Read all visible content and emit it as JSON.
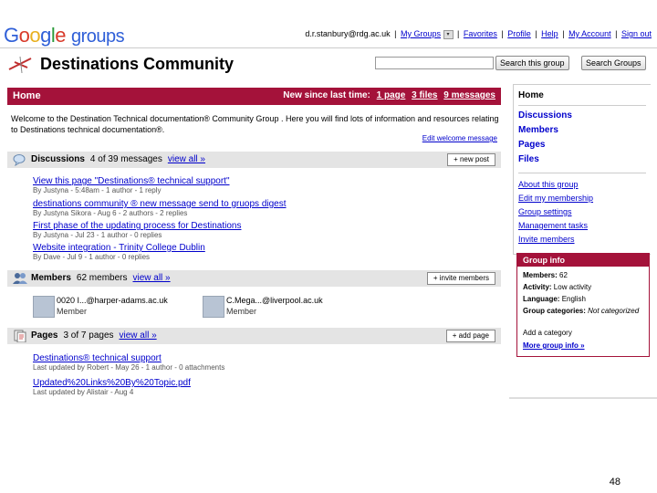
{
  "header": {
    "logo_google": "Google",
    "logo_groups": "groups",
    "email": "d.r.stanbury@rdg.ac.uk",
    "links": [
      "My Groups",
      "Favorites",
      "Profile",
      "Help",
      "My Account",
      "Sign out"
    ]
  },
  "group": {
    "title": "Destinations Community",
    "search_group_label": "Search this group",
    "search_groups_label": "Search Groups"
  },
  "home": {
    "title": "Home",
    "new_since": "New since last time:",
    "new_page": "1 page",
    "new_files": "3 files",
    "new_messages": "9 messages",
    "welcome_text": "Welcome to the Destination Technical documentation® Community Group . Here you will find lots of information and resources relating to Destinations technical documentation®.",
    "edit_welcome": "Edit welcome message"
  },
  "discussions": {
    "label": "Discussions",
    "count": "4 of 39 messages",
    "view_all": "view all »",
    "button": "+ new post",
    "items": [
      {
        "title": "View this page \"Destinations® technical support\"",
        "meta": "By Justyna - 5:48am - 1 author - 1 reply"
      },
      {
        "title": "destinations community ® new message send to gruops digest",
        "meta": "By Justyna Sikora - Aug 6 - 2 authors - 2 replies"
      },
      {
        "title": "First phase of the updating process for Destinations",
        "meta": "By Justyna - Jul 23 - 1 author - 0 replies"
      },
      {
        "title": "Website integration - Trinity College Dublin",
        "meta": "By Dave - Jul 9 - 1 author - 0 replies"
      }
    ]
  },
  "members": {
    "label": "Members",
    "count": "62 members",
    "view_all": "view all »",
    "button": "+ invite members",
    "items": [
      {
        "email": "0020 I...@harper-adams.ac.uk",
        "role": "Member"
      },
      {
        "email": "C.Mega...@liverpool.ac.uk",
        "role": "Member"
      }
    ]
  },
  "pages": {
    "label": "Pages",
    "count": "3 of 7 pages",
    "view_all": "view all »",
    "button": "+ add page",
    "items": [
      {
        "title": "Destinations® technical support",
        "meta": "Last updated by Robert - May 26 - 1 author - 0 attachments"
      },
      {
        "title": "Updated%20Links%20By%20Topic.pdf",
        "meta": "Last updated by Alistair - Aug 4"
      }
    ]
  },
  "sidebar": {
    "home": "Home",
    "nav": [
      "Discussions",
      "Members",
      "Pages",
      "Files"
    ],
    "links": [
      "About this group",
      "Edit my membership",
      "Group settings",
      "Management tasks",
      "Invite members"
    ]
  },
  "group_info": {
    "title": "Group info",
    "members_label": "Members:",
    "members_value": "62",
    "activity_label": "Activity:",
    "activity_value": "Low activity",
    "language_label": "Language:",
    "language_value": "English",
    "categories_label": "Group categories:",
    "categories_value": "Not categorized",
    "add_category": "Add a category",
    "more": "More group info »"
  },
  "page_number": "48",
  "colors": {
    "accent": "#a4123a",
    "link": "#0000cc",
    "section_bg": "#e4e4e4"
  }
}
